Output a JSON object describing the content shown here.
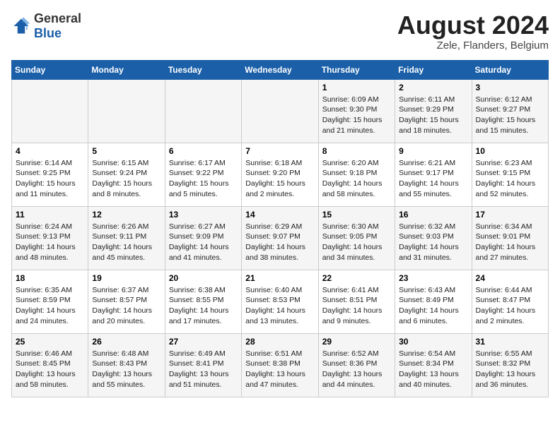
{
  "header": {
    "logo_general": "General",
    "logo_blue": "Blue",
    "main_title": "August 2024",
    "subtitle": "Zele, Flanders, Belgium"
  },
  "days_of_week": [
    "Sunday",
    "Monday",
    "Tuesday",
    "Wednesday",
    "Thursday",
    "Friday",
    "Saturday"
  ],
  "weeks": [
    [
      {
        "day": "",
        "info": ""
      },
      {
        "day": "",
        "info": ""
      },
      {
        "day": "",
        "info": ""
      },
      {
        "day": "",
        "info": ""
      },
      {
        "day": "1",
        "info": "Sunrise: 6:09 AM\nSunset: 9:30 PM\nDaylight: 15 hours\nand 21 minutes."
      },
      {
        "day": "2",
        "info": "Sunrise: 6:11 AM\nSunset: 9:29 PM\nDaylight: 15 hours\nand 18 minutes."
      },
      {
        "day": "3",
        "info": "Sunrise: 6:12 AM\nSunset: 9:27 PM\nDaylight: 15 hours\nand 15 minutes."
      }
    ],
    [
      {
        "day": "4",
        "info": "Sunrise: 6:14 AM\nSunset: 9:25 PM\nDaylight: 15 hours\nand 11 minutes."
      },
      {
        "day": "5",
        "info": "Sunrise: 6:15 AM\nSunset: 9:24 PM\nDaylight: 15 hours\nand 8 minutes."
      },
      {
        "day": "6",
        "info": "Sunrise: 6:17 AM\nSunset: 9:22 PM\nDaylight: 15 hours\nand 5 minutes."
      },
      {
        "day": "7",
        "info": "Sunrise: 6:18 AM\nSunset: 9:20 PM\nDaylight: 15 hours\nand 2 minutes."
      },
      {
        "day": "8",
        "info": "Sunrise: 6:20 AM\nSunset: 9:18 PM\nDaylight: 14 hours\nand 58 minutes."
      },
      {
        "day": "9",
        "info": "Sunrise: 6:21 AM\nSunset: 9:17 PM\nDaylight: 14 hours\nand 55 minutes."
      },
      {
        "day": "10",
        "info": "Sunrise: 6:23 AM\nSunset: 9:15 PM\nDaylight: 14 hours\nand 52 minutes."
      }
    ],
    [
      {
        "day": "11",
        "info": "Sunrise: 6:24 AM\nSunset: 9:13 PM\nDaylight: 14 hours\nand 48 minutes."
      },
      {
        "day": "12",
        "info": "Sunrise: 6:26 AM\nSunset: 9:11 PM\nDaylight: 14 hours\nand 45 minutes."
      },
      {
        "day": "13",
        "info": "Sunrise: 6:27 AM\nSunset: 9:09 PM\nDaylight: 14 hours\nand 41 minutes."
      },
      {
        "day": "14",
        "info": "Sunrise: 6:29 AM\nSunset: 9:07 PM\nDaylight: 14 hours\nand 38 minutes."
      },
      {
        "day": "15",
        "info": "Sunrise: 6:30 AM\nSunset: 9:05 PM\nDaylight: 14 hours\nand 34 minutes."
      },
      {
        "day": "16",
        "info": "Sunrise: 6:32 AM\nSunset: 9:03 PM\nDaylight: 14 hours\nand 31 minutes."
      },
      {
        "day": "17",
        "info": "Sunrise: 6:34 AM\nSunset: 9:01 PM\nDaylight: 14 hours\nand 27 minutes."
      }
    ],
    [
      {
        "day": "18",
        "info": "Sunrise: 6:35 AM\nSunset: 8:59 PM\nDaylight: 14 hours\nand 24 minutes."
      },
      {
        "day": "19",
        "info": "Sunrise: 6:37 AM\nSunset: 8:57 PM\nDaylight: 14 hours\nand 20 minutes."
      },
      {
        "day": "20",
        "info": "Sunrise: 6:38 AM\nSunset: 8:55 PM\nDaylight: 14 hours\nand 17 minutes."
      },
      {
        "day": "21",
        "info": "Sunrise: 6:40 AM\nSunset: 8:53 PM\nDaylight: 14 hours\nand 13 minutes."
      },
      {
        "day": "22",
        "info": "Sunrise: 6:41 AM\nSunset: 8:51 PM\nDaylight: 14 hours\nand 9 minutes."
      },
      {
        "day": "23",
        "info": "Sunrise: 6:43 AM\nSunset: 8:49 PM\nDaylight: 14 hours\nand 6 minutes."
      },
      {
        "day": "24",
        "info": "Sunrise: 6:44 AM\nSunset: 8:47 PM\nDaylight: 14 hours\nand 2 minutes."
      }
    ],
    [
      {
        "day": "25",
        "info": "Sunrise: 6:46 AM\nSunset: 8:45 PM\nDaylight: 13 hours\nand 58 minutes."
      },
      {
        "day": "26",
        "info": "Sunrise: 6:48 AM\nSunset: 8:43 PM\nDaylight: 13 hours\nand 55 minutes."
      },
      {
        "day": "27",
        "info": "Sunrise: 6:49 AM\nSunset: 8:41 PM\nDaylight: 13 hours\nand 51 minutes."
      },
      {
        "day": "28",
        "info": "Sunrise: 6:51 AM\nSunset: 8:38 PM\nDaylight: 13 hours\nand 47 minutes."
      },
      {
        "day": "29",
        "info": "Sunrise: 6:52 AM\nSunset: 8:36 PM\nDaylight: 13 hours\nand 44 minutes."
      },
      {
        "day": "30",
        "info": "Sunrise: 6:54 AM\nSunset: 8:34 PM\nDaylight: 13 hours\nand 40 minutes."
      },
      {
        "day": "31",
        "info": "Sunrise: 6:55 AM\nSunset: 8:32 PM\nDaylight: 13 hours\nand 36 minutes."
      }
    ]
  ]
}
